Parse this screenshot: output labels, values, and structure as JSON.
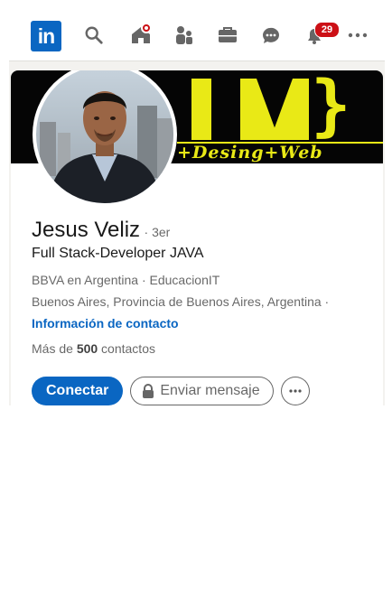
{
  "nav": {
    "logo": "in",
    "icons": [
      "search-icon",
      "home-icon",
      "my-network-icon",
      "jobs-icon",
      "messaging-icon",
      "notifications-icon",
      "more-icon"
    ],
    "notifications_count": "29",
    "accent": "#0a66c2",
    "badge_color": "#cc1016"
  },
  "banner": {
    "text": "+Desing+Web",
    "color": "#e9e916"
  },
  "profile": {
    "name": "Jesus Veliz",
    "degree": "· 3er",
    "headline": "Full Stack-Developer JAVA",
    "company": "BBVA en Argentina · EducacionIT",
    "location": "Buenos Aires, Provincia de Buenos Aires, Argentina ·",
    "contact_link": "Información de contacto",
    "connections_prefix": "Más de ",
    "connections_count": "500",
    "connections_suffix": " contactos"
  },
  "actions": {
    "connect_label": "Conectar",
    "message_label": "Enviar mensaje",
    "more_icon": "more-horizontal-icon"
  }
}
